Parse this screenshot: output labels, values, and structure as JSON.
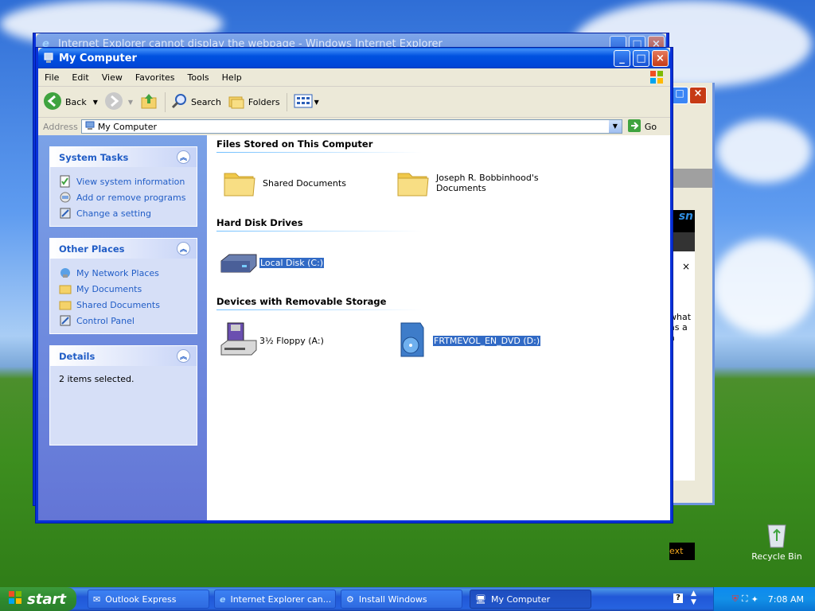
{
  "colors": {
    "xp_blue": "#0831d9",
    "link": "#215dc6",
    "selection": "#316ac5"
  },
  "ie_back": {
    "title": "Internet Explorer cannot display the webpage - Windows Internet Explorer"
  },
  "window": {
    "title": "My Computer",
    "menu": [
      "File",
      "Edit",
      "View",
      "Favorites",
      "Tools",
      "Help"
    ],
    "toolbar": {
      "back": "Back",
      "search": "Search",
      "folders": "Folders"
    },
    "address": {
      "label": "Address",
      "value": "My Computer",
      "go": "Go"
    }
  },
  "left": {
    "system_tasks": {
      "title": "System Tasks",
      "items": [
        "View system information",
        "Add or remove programs",
        "Change a setting"
      ]
    },
    "other_places": {
      "title": "Other Places",
      "items": [
        "My Network Places",
        "My Documents",
        "Shared Documents",
        "Control Panel"
      ]
    },
    "details": {
      "title": "Details",
      "text": "2 items selected."
    }
  },
  "main": {
    "files_header": "Files Stored on This Computer",
    "shared_docs": "Shared Documents",
    "user_docs": "Joseph R. Bobbinhood's Documents",
    "hdd_header": "Hard Disk Drives",
    "local_disk": "Local Disk (C:)",
    "removable_header": "Devices with Removable Storage",
    "floppy": "3½ Floppy (A:)",
    "dvd": "FRTMEVOL_EN_DVD (D:)"
  },
  "ie_fragments": {
    "close": "×",
    "what": "what",
    "as_a": "as a",
    "a": "a",
    "next": "ext"
  },
  "desktop": {
    "recycle_bin": "Recycle Bin"
  },
  "taskbar": {
    "start": "start",
    "buttons": [
      "Outlook Express",
      "Internet Explorer can...",
      "Install Windows",
      "My Computer"
    ],
    "clock": "7:08 AM"
  }
}
